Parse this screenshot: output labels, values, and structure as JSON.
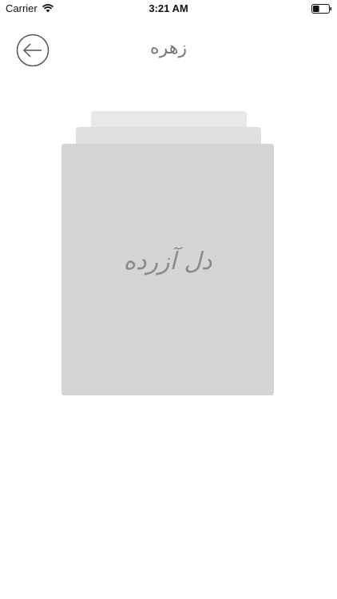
{
  "status_bar": {
    "carrier": "Carrier",
    "time": "3:21 AM",
    "wifi_icon": "wifi-icon",
    "battery_icon": "battery-icon",
    "battery_level": 0.4
  },
  "header": {
    "title": "زهره",
    "back_icon": "arrow-left-circle-icon"
  },
  "card": {
    "text": "دل آزرده"
  },
  "colors": {
    "card_front": "#d5d5d5",
    "card_back_1": "#e0e0e0",
    "card_back_2": "#e8e8e8",
    "text_gray": "#8a8a8a"
  }
}
